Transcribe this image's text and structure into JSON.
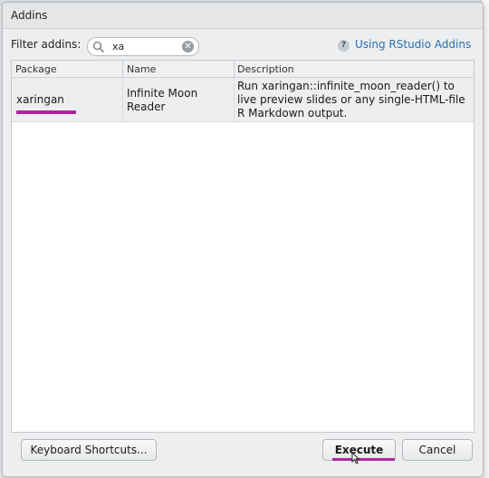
{
  "dialog": {
    "title": "Addins",
    "filter_label": "Filter addins:",
    "search": {
      "value": "xa"
    },
    "help_link": "Using RStudio Addins",
    "columns": [
      "Package",
      "Name",
      "Description"
    ],
    "rows": [
      {
        "package": "xaringan",
        "name_lines": [
          "Infinite Moon",
          "Reader"
        ],
        "description_lines": [
          "Run xaringan::infinite_moon_reader() to",
          "live preview slides or any single-HTML-file",
          "R Markdown output."
        ]
      }
    ],
    "buttons": {
      "keyboard_shortcuts": "Keyboard Shortcuts...",
      "execute": "Execute",
      "cancel": "Cancel"
    }
  },
  "colors": {
    "accent_underline": "#b0249f",
    "link": "#2a6fb3",
    "selected_row": "#eceeef"
  },
  "icons": [
    "search-icon",
    "clear-icon",
    "help-icon",
    "pointer-cursor-icon"
  ]
}
